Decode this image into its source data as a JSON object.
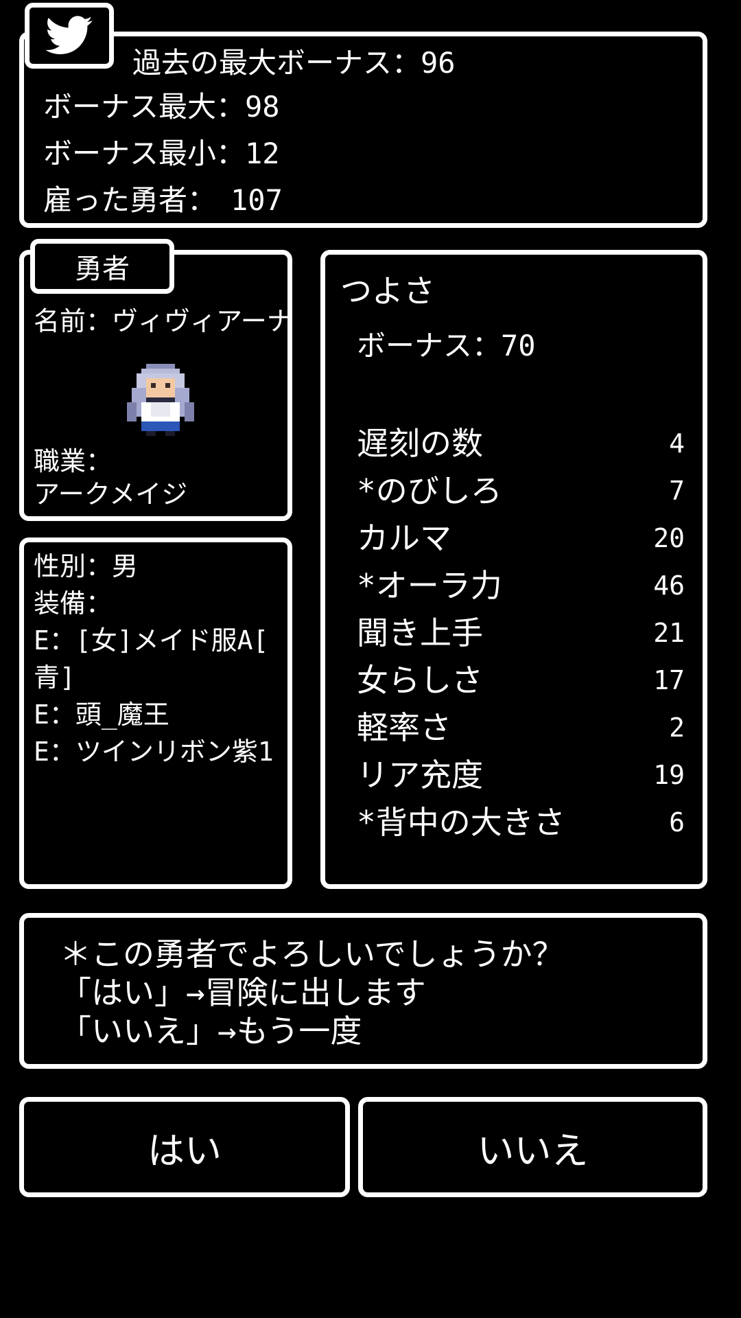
{
  "colors": {
    "background": "#000000",
    "border": "#ffffff",
    "text": "#ffffff",
    "twitter": "#ffffff"
  },
  "icons": {
    "share": "twitter-bird-icon"
  },
  "bonus_panel": {
    "past_max_bonus": "過去の最大ボーナス：96",
    "bonus_max": "ボーナス最大：98",
    "bonus_min": "ボーナス最小：12",
    "hired_heroes": "雇った勇者：　107"
  },
  "hero_panel": {
    "tab_label": "勇者",
    "name": "名前：ヴィヴィアーナ",
    "job_label": "職業：",
    "job_value": "アークメイジ"
  },
  "equipment_panel": {
    "gender": "性別：男",
    "equip_label": "装備：",
    "items": [
      "E：[女]メイド服A[",
      "青]",
      "E：頭_魔王",
      "E：ツインリボン紫1"
    ]
  },
  "stats_panel": {
    "title": "つよさ",
    "bonus": "ボーナス：70",
    "stats": [
      {
        "name": "遅刻の数",
        "value": "4"
      },
      {
        "name": "*のびしろ",
        "value": "7"
      },
      {
        "name": "カルマ",
        "value": "20"
      },
      {
        "name": "*オーラ力",
        "value": "46"
      },
      {
        "name": "聞き上手",
        "value": "21"
      },
      {
        "name": "女らしさ",
        "value": "17"
      },
      {
        "name": "軽率さ",
        "value": "2"
      },
      {
        "name": "リア充度",
        "value": "19"
      },
      {
        "name": "*背中の大きさ",
        "value": "6"
      }
    ]
  },
  "message": {
    "line1": "＊この勇者でよろしいでしょうか？",
    "line2": "「はい」→冒険に出します",
    "line3": "「いいえ」→もう一度"
  },
  "buttons": {
    "yes": "はい",
    "no": "いいえ"
  }
}
